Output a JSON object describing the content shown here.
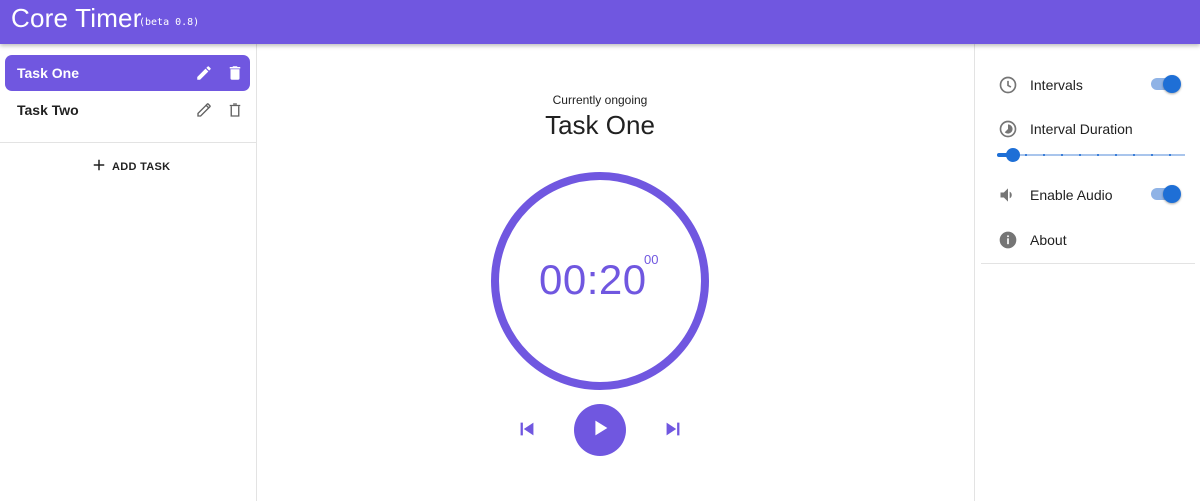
{
  "app": {
    "title": "Core Timer",
    "version": "(beta 0.8)",
    "accent_color": "#7057e0"
  },
  "tasks": {
    "items": [
      {
        "label": "Task One",
        "active": true,
        "edit_icon": "pencil-icon",
        "delete_icon": "trash-icon"
      },
      {
        "label": "Task Two",
        "active": false,
        "edit_icon": "pencil-icon",
        "delete_icon": "trash-icon"
      }
    ],
    "add_label": "ADD TASK",
    "add_icon": "plus-icon"
  },
  "timer": {
    "ongoing_label": "Currently ongoing",
    "task_name": "Task One",
    "display": "00:20",
    "subseconds": "00",
    "controls": [
      "skip-previous-icon",
      "play-icon",
      "skip-next-icon"
    ]
  },
  "settings": {
    "items": [
      {
        "label": "Intervals",
        "icon": "clock-icon",
        "toggle": true
      },
      {
        "label": "Interval Duration",
        "icon": "timelapse-icon",
        "slider_step": 1,
        "slider_steps": 10
      },
      {
        "label": "Enable Audio",
        "icon": "volume-icon",
        "toggle": true
      },
      {
        "label": "About",
        "icon": "info-icon"
      }
    ],
    "toggle_color": "#1e6fd6"
  }
}
